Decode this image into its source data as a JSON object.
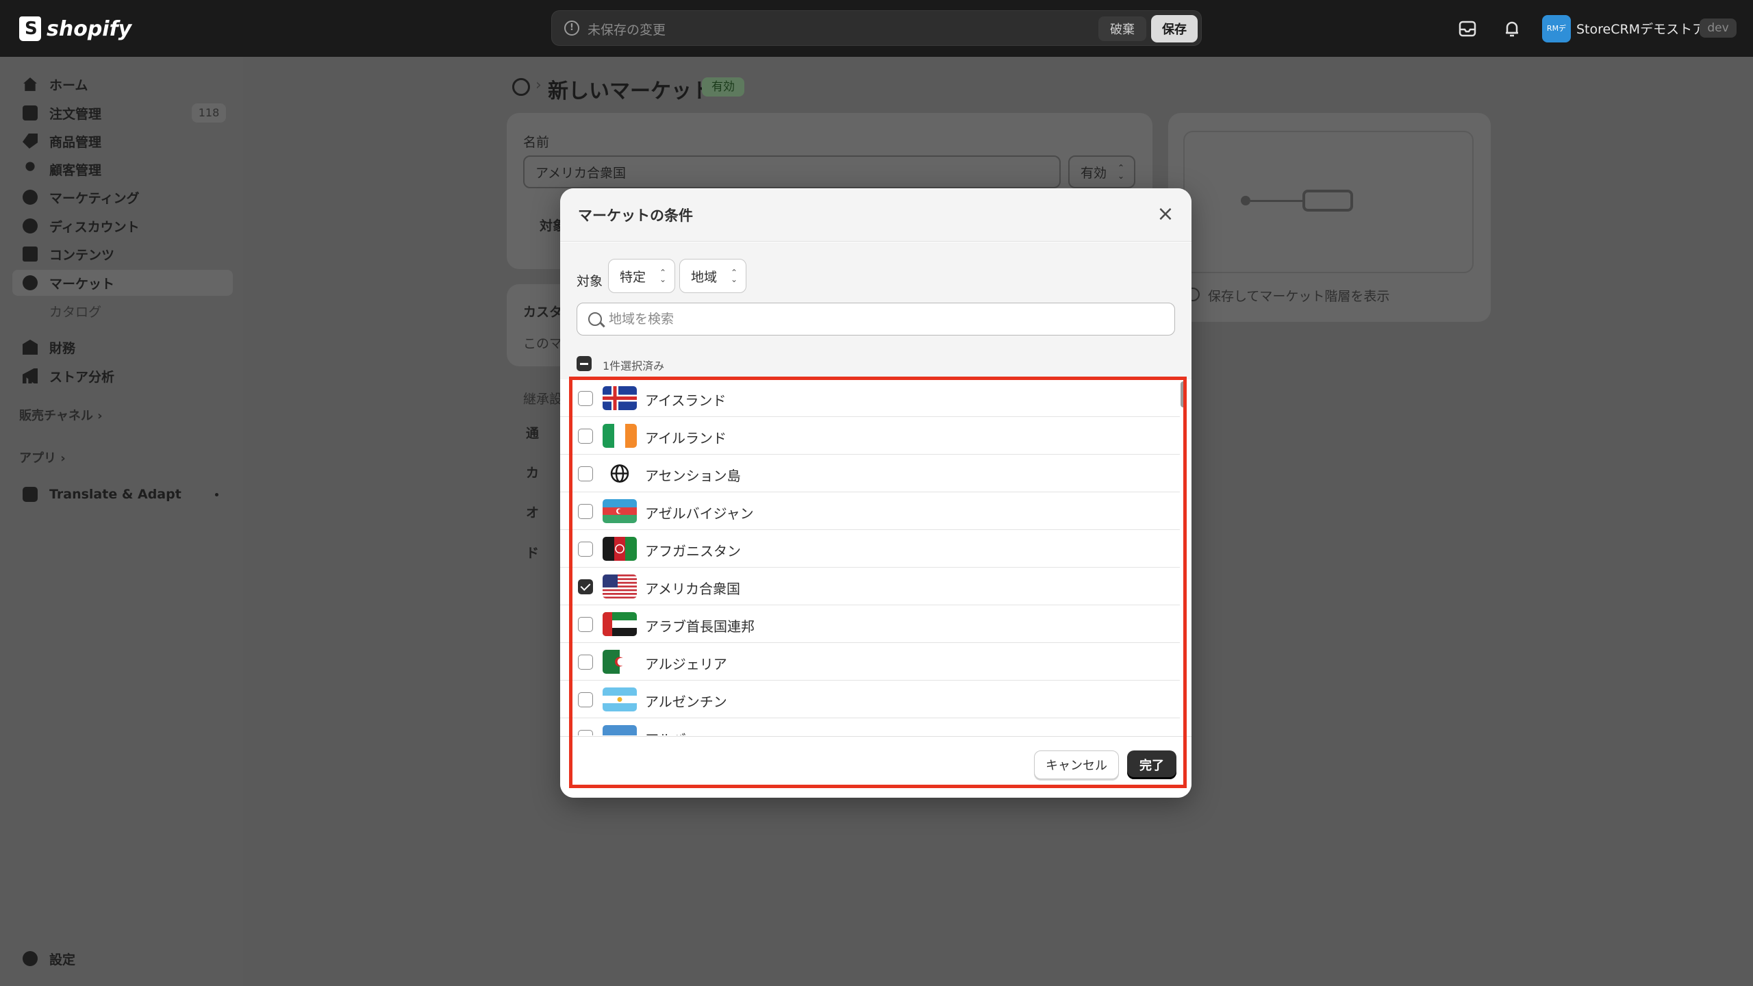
{
  "topbar": {
    "logo_text": "shopify",
    "unsaved_text": "未保存の変更",
    "discard_label": "破棄",
    "save_label": "保存",
    "store_avatar_text": "RMデ",
    "store_name": "StoreCRMデモストア",
    "env_badge": "dev"
  },
  "sidebar": {
    "items": [
      {
        "label": "ホーム",
        "icon": "home-icon"
      },
      {
        "label": "注文管理",
        "icon": "order-icon",
        "count": "118"
      },
      {
        "label": "商品管理",
        "icon": "tag-icon"
      },
      {
        "label": "顧客管理",
        "icon": "person-icon"
      },
      {
        "label": "マーケティング",
        "icon": "target-icon"
      },
      {
        "label": "ディスカウント",
        "icon": "discount-icon"
      },
      {
        "label": "コンテンツ",
        "icon": "content-icon"
      },
      {
        "label": "マーケット",
        "icon": "globe-icon"
      },
      {
        "label": "カタログ"
      },
      {
        "label": "財務",
        "icon": "bank-icon"
      },
      {
        "label": "ストア分析",
        "icon": "chart-icon"
      }
    ],
    "sales_channels_label": "販売チャネル ›",
    "apps_label": "アプリ ›",
    "app_item_label": "Translate & Adapt",
    "settings_label": "設定"
  },
  "page": {
    "title": "新しいマーケット",
    "status_badge": "有効",
    "name_label": "名前",
    "name_value": "アメリカ合衆国",
    "status_select": "有効",
    "hidden_label_1": "対象",
    "hidden_label_2": "カスタ",
    "hidden_label_3": "このマ",
    "hidden_label_4": "継承設",
    "hidden_label_5": "通",
    "hidden_label_6": "カ",
    "hidden_label_7": "オ",
    "hidden_label_8": "ド",
    "hierarchy_hint": "保存してマーケット階層を表示"
  },
  "modal": {
    "title": "マーケットの条件",
    "target_label": "対象",
    "target_select": "特定",
    "scope_select": "地域",
    "search_placeholder": "地域を検索",
    "selected_count": "1件選択済み",
    "countries": [
      {
        "name": "アイスランド",
        "checked": false
      },
      {
        "name": "アイルランド",
        "checked": false
      },
      {
        "name": "アセンション島",
        "checked": false
      },
      {
        "name": "アゼルバイジャン",
        "checked": false
      },
      {
        "name": "アフガニスタン",
        "checked": false
      },
      {
        "name": "アメリカ合衆国",
        "checked": true
      },
      {
        "name": "アラブ首長国連邦",
        "checked": false
      },
      {
        "name": "アルジェリア",
        "checked": false
      },
      {
        "name": "アルゼンチン",
        "checked": false
      },
      {
        "name": "アルバ",
        "checked": false
      }
    ],
    "cancel_label": "キャンセル",
    "done_label": "完了"
  },
  "colors": {
    "highlight": "#e8321e",
    "primary_button": "#303030"
  }
}
